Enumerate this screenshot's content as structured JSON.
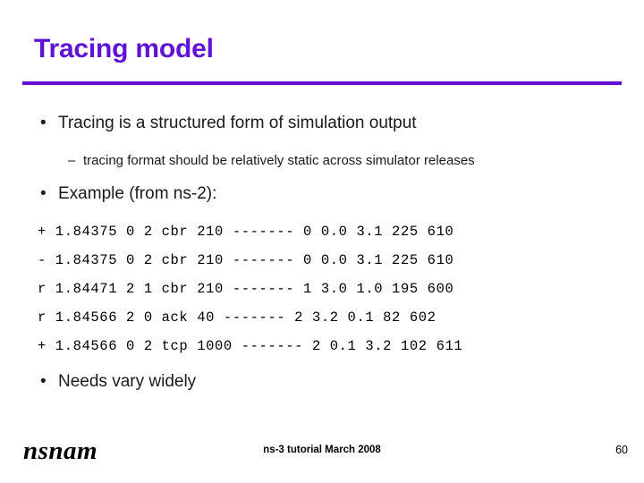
{
  "slide": {
    "title": "Tracing model",
    "accent_color": "#6111d6",
    "background_color": "#ffffff",
    "text_color": "#000000"
  },
  "bullets": {
    "level1_marker": "•",
    "level2_marker": "–",
    "item1": "Tracing is a structured form of simulation output",
    "item1_sub1": "tracing format should be relatively static across simulator releases",
    "item2": "Example (from ns-2):",
    "item3": "Needs vary widely"
  },
  "trace": {
    "lines": [
      "+ 1.84375 0 2 cbr 210 ------- 0 0.0 3.1 225 610",
      "- 1.84375 0 2 cbr 210 ------- 0 0.0 3.1 225 610",
      "r 1.84471 2 1 cbr 210 ------- 1 3.0 1.0 195 600",
      "r 1.84566 2 0 ack 40 ------- 2 3.2 0.1 82 602",
      "+ 1.84566 0 2 tcp 1000 ------- 2 0.1 3.2 102 611"
    ]
  },
  "footer": {
    "logo_text": "nsnam",
    "center_text": "ns-3 tutorial March 2008",
    "page_number": "60"
  }
}
